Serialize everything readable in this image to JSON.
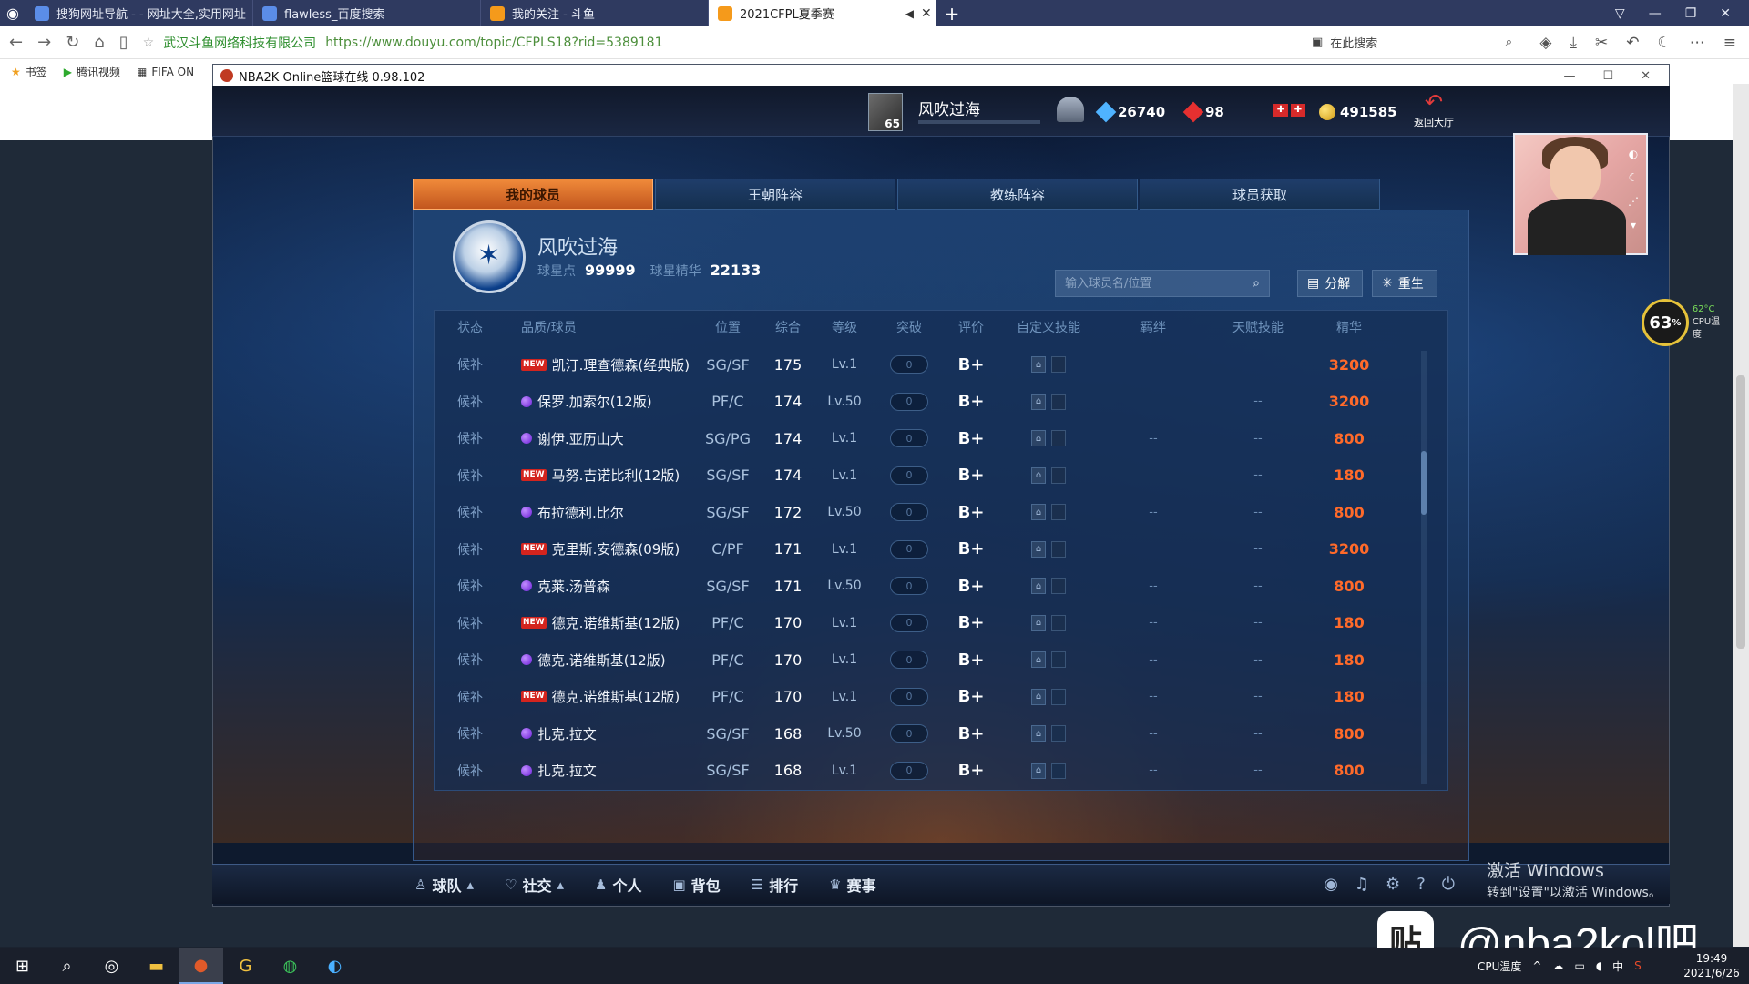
{
  "browser": {
    "tabs": [
      {
        "label": "搜狗网址导航 - - 网址大全,实用网址",
        "active": false
      },
      {
        "label": "flawless_百度搜索",
        "active": false
      },
      {
        "label": "我的关注 - 斗鱼",
        "active": false
      },
      {
        "label": "2021CFPL夏季赛",
        "active": true
      }
    ],
    "site_name": "武汉斗鱼网络科技有限公司",
    "url": "https://www.douyu.com/topic/CFPLS18?rid=5389181",
    "search_placeholder": "在此搜索",
    "bookmarks": [
      "书签",
      "腾讯视频",
      "FIFA ON"
    ]
  },
  "game": {
    "window_title": "NBA2K Online篮球在线 0.98.102",
    "player_level": "65",
    "player_name": "风吹过海",
    "diamonds": "26740",
    "rubies": "98",
    "coins": "491585",
    "back_label": "返回大厅",
    "tabs": [
      "我的球员",
      "王朝阵容",
      "教练阵容",
      "球员获取"
    ],
    "active_tab": 0,
    "profile": {
      "name": "风吹过海",
      "star_points_label": "球星点",
      "star_points": "99999",
      "essence_label": "球星精华",
      "essence": "22133"
    },
    "search_placeholder": "输入球员名/位置",
    "decompose_label": "分解",
    "rebirth_label": "重生",
    "columns": [
      "状态",
      "品质/球员",
      "位置",
      "综合",
      "等级",
      "突破",
      "评价",
      "自定义技能",
      "羁绊",
      "天赋技能",
      "精华"
    ],
    "players": [
      {
        "status": "候补",
        "badge": "NEW",
        "name": "凯汀.理查德森(经典版)",
        "pos": "SG/SF",
        "ovr": "175",
        "lvl": "Lv.1",
        "break": "0",
        "grade": "B+",
        "bond": "",
        "talent": "",
        "essence": "3200"
      },
      {
        "status": "候补",
        "badge": "orb",
        "name": "保罗.加索尔(12版)",
        "pos": "PF/C",
        "ovr": "174",
        "lvl": "Lv.50",
        "break": "0",
        "grade": "B+",
        "bond": "",
        "talent": "--",
        "essence": "3200"
      },
      {
        "status": "候补",
        "badge": "orb",
        "name": "谢伊.亚历山大",
        "pos": "SG/PG",
        "ovr": "174",
        "lvl": "Lv.1",
        "break": "0",
        "grade": "B+",
        "bond": "--",
        "talent": "--",
        "essence": "800"
      },
      {
        "status": "候补",
        "badge": "NEW",
        "name": "马努.吉诺比利(12版)",
        "pos": "SG/SF",
        "ovr": "174",
        "lvl": "Lv.1",
        "break": "0",
        "grade": "B+",
        "bond": "",
        "talent": "--",
        "essence": "180"
      },
      {
        "status": "候补",
        "badge": "orb",
        "name": "布拉德利.比尔",
        "pos": "SG/SF",
        "ovr": "172",
        "lvl": "Lv.50",
        "break": "0",
        "grade": "B+",
        "bond": "--",
        "talent": "--",
        "essence": "800"
      },
      {
        "status": "候补",
        "badge": "NEW",
        "name": "克里斯.安德森(09版)",
        "pos": "C/PF",
        "ovr": "171",
        "lvl": "Lv.1",
        "break": "0",
        "grade": "B+",
        "bond": "",
        "talent": "--",
        "essence": "3200"
      },
      {
        "status": "候补",
        "badge": "orb",
        "name": "克莱.汤普森",
        "pos": "SG/SF",
        "ovr": "171",
        "lvl": "Lv.50",
        "break": "0",
        "grade": "B+",
        "bond": "--",
        "talent": "--",
        "essence": "800"
      },
      {
        "status": "候补",
        "badge": "NEW",
        "name": "德克.诺维斯基(12版)",
        "pos": "PF/C",
        "ovr": "170",
        "lvl": "Lv.1",
        "break": "0",
        "grade": "B+",
        "bond": "--",
        "talent": "--",
        "essence": "180"
      },
      {
        "status": "候补",
        "badge": "orb",
        "name": "德克.诺维斯基(12版)",
        "pos": "PF/C",
        "ovr": "170",
        "lvl": "Lv.1",
        "break": "0",
        "grade": "B+",
        "bond": "--",
        "talent": "--",
        "essence": "180"
      },
      {
        "status": "候补",
        "badge": "NEW",
        "name": "德克.诺维斯基(12版)",
        "pos": "PF/C",
        "ovr": "170",
        "lvl": "Lv.1",
        "break": "0",
        "grade": "B+",
        "bond": "--",
        "talent": "--",
        "essence": "180"
      },
      {
        "status": "候补",
        "badge": "orb",
        "name": "扎克.拉文",
        "pos": "SG/SF",
        "ovr": "168",
        "lvl": "Lv.50",
        "break": "0",
        "grade": "B+",
        "bond": "--",
        "talent": "--",
        "essence": "800"
      },
      {
        "status": "候补",
        "badge": "orb",
        "name": "扎克.拉文",
        "pos": "SG/SF",
        "ovr": "168",
        "lvl": "Lv.1",
        "break": "0",
        "grade": "B+",
        "bond": "--",
        "talent": "--",
        "essence": "800"
      }
    ],
    "bottom_nav": [
      "球队",
      "社交",
      "个人",
      "背包",
      "排行",
      "赛事"
    ]
  },
  "overlay": {
    "cpu_percent": "63",
    "cpu_temp": "62°C",
    "cpu_label": "CPU温度",
    "activate_title": "激活 Windows",
    "activate_sub": "转到\"设置\"以激活 Windows。",
    "watermark_icon": "贴",
    "watermark": "@nba2kol吧"
  },
  "taskbar": {
    "tray_label": "CPU温度",
    "ime": "中",
    "time": "19:49",
    "date": "2021/6/26"
  },
  "colors": {
    "accent_orange": "#f08a3a",
    "essence_orange": "#ff6a2a",
    "panel_blue": "#1f3d6a"
  }
}
